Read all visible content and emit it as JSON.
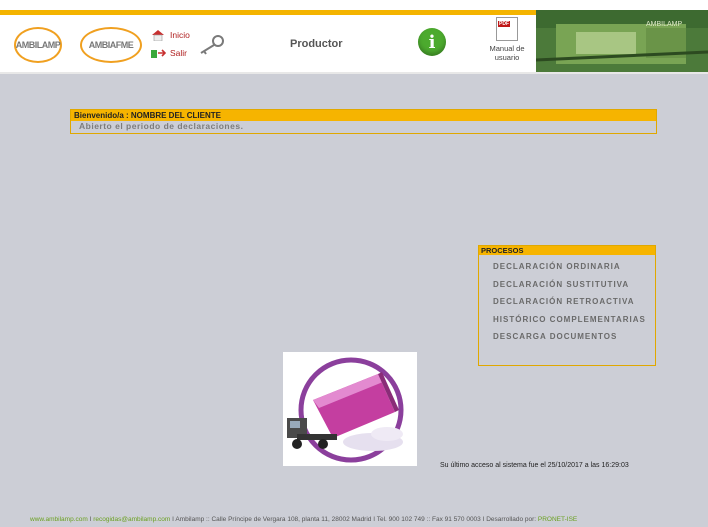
{
  "header": {
    "logos": [
      "AMBILAMP",
      "AMBIAFME"
    ],
    "nav": {
      "inicio": "Inicio",
      "salir": "Salir"
    },
    "title": "Productor",
    "info_icon": "i",
    "manual": {
      "line1": "Manual de",
      "line2": "usuario",
      "pdf_badge": "PDF"
    },
    "banner_text": "AMBILAMP"
  },
  "welcome": {
    "heading": "Bienvenido/a : NOMBRE DEL CLIENTE",
    "message": "Abierto el periodo de declaraciones."
  },
  "procesos": {
    "title": "PROCESOS",
    "items": [
      "DECLARACIÓN ORDINARIA",
      "DECLARACIÓN SUSTITUTIVA",
      "DECLARACIÓN RETROACTIVA",
      "HISTÓRICO COMPLEMENTARIAS",
      "DESCARGA DOCUMENTOS"
    ]
  },
  "last_access": "Su último acceso al sistema fue el 25/10/2017 a las 16:29:03",
  "footer": {
    "site": "www.ambilamp.com",
    "sep": " I ",
    "email": "recogidas@ambilamp.com",
    "address": "Ambilamp :: Calle Príncipe de Vergara 108, planta 11, 28002 Madrid I Tel. 900 102 749 :: Fax 91 570 0003 I Desarrollado por: ",
    "developer": "PRONET-ISE"
  },
  "colors": {
    "accent": "#f6b400",
    "background": "#ccced6",
    "link": "#b02020",
    "info": "#4caa2e"
  }
}
